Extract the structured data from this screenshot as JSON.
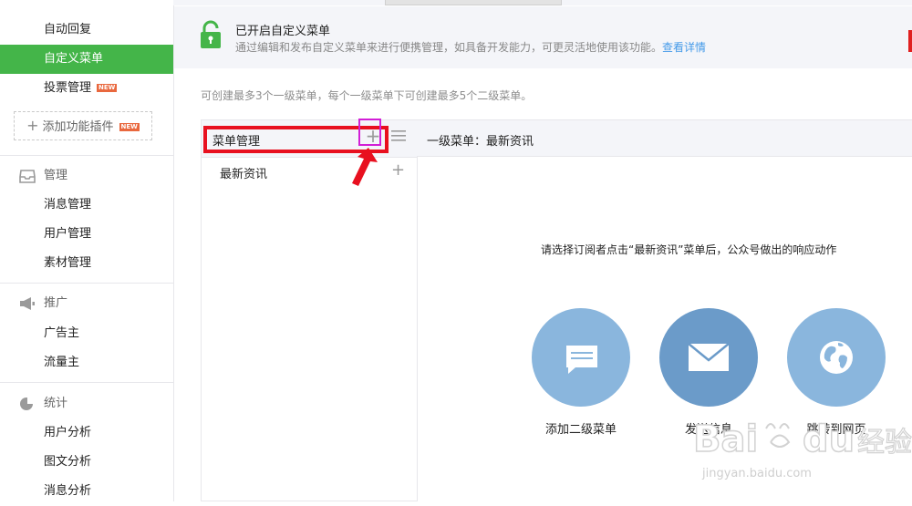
{
  "sidebar": {
    "items_top": [
      {
        "label": "自动回复"
      },
      {
        "label": "自定义菜单",
        "active": true
      },
      {
        "label": "投票管理",
        "badge": "NEW"
      }
    ],
    "plugin_button": {
      "label": "添加功能插件",
      "badge": "NEW"
    },
    "sections": [
      {
        "title": "管理",
        "icon": "inbox-icon",
        "items": [
          "消息管理",
          "用户管理",
          "素材管理"
        ]
      },
      {
        "title": "推广",
        "icon": "megaphone-icon",
        "items": [
          "广告主",
          "流量主"
        ]
      },
      {
        "title": "统计",
        "icon": "pie-chart-icon",
        "items": [
          "用户分析",
          "图文分析",
          "消息分析"
        ]
      }
    ]
  },
  "notice": {
    "icon": "lock-icon",
    "title": "已开启自定义菜单",
    "description": "通过编辑和发布自定义菜单来进行便携管理，如具备开发能力，可更灵活地使用该功能。",
    "link": "查看详情"
  },
  "hint": "可创建最多3个一级菜单，每个一级菜单下可创建最多5个二级菜单。",
  "menu_editor": {
    "title": "菜单管理",
    "items": [
      {
        "label": "最新资讯"
      }
    ]
  },
  "detail": {
    "title": "一级菜单：最新资讯",
    "prompt": "请选择订阅者点击“最新资讯”菜单后，公众号做出的响应动作",
    "actions": [
      {
        "label": "添加二级菜单",
        "icon": "message-icon",
        "color": "#8ab6dd"
      },
      {
        "label": "发送信息",
        "icon": "envelope-icon",
        "color": "#6b9bc9"
      },
      {
        "label": "跳转到网页",
        "icon": "globe-icon",
        "color": "#8ab6dd"
      }
    ]
  },
  "colors": {
    "accent": "#44b549",
    "link": "#459ae9",
    "annotation_red": "#e8101f",
    "annotation_magenta": "#d21fd6"
  },
  "watermark": {
    "brand": "Bai du 经验",
    "url": "jingyan.baidu.com"
  }
}
